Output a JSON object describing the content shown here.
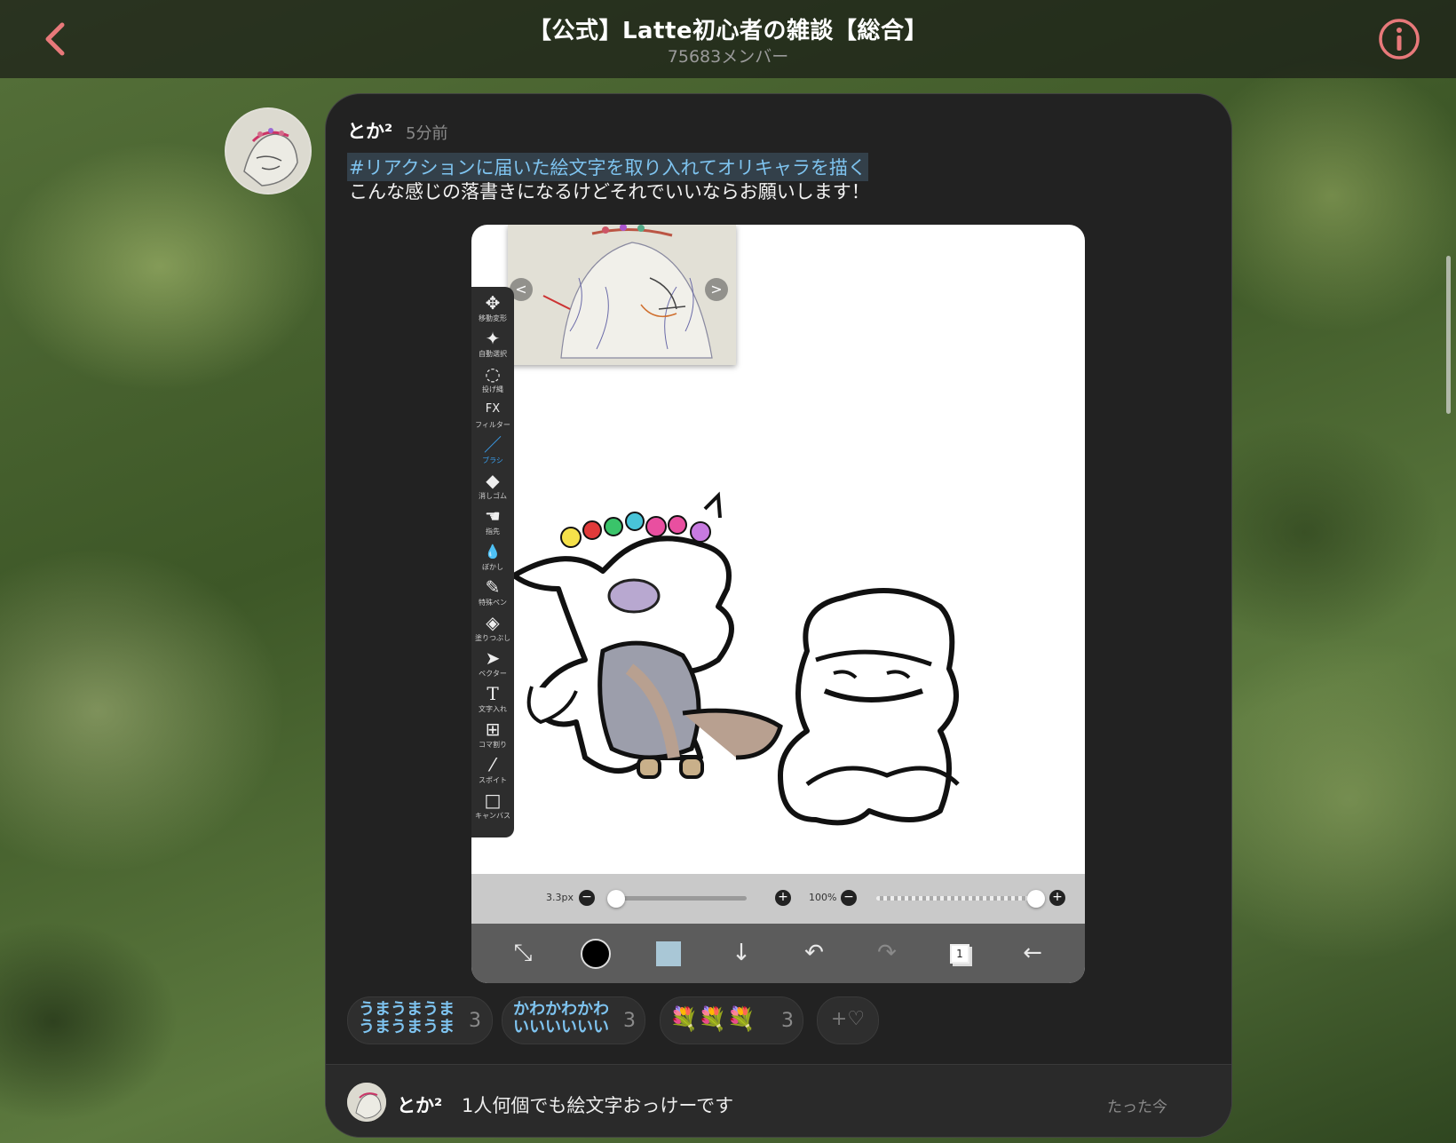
{
  "header": {
    "title": "【公式】Latte初心者の雑談【総合】",
    "member_count": "75683メンバー",
    "back_icon": "chevron-left-icon",
    "info_icon": "info-circle-icon",
    "accent_color": "#e8797a"
  },
  "post": {
    "author": "とか²",
    "time": "5分前",
    "hashtag": "#リアクションに届いた絵文字を取り入れてオリキャラを描く",
    "body": "こんな感じの落書きになるけどそれでいいならお願いします！",
    "image": {
      "tools": [
        {
          "icon": "move-transform-icon",
          "glyph": "✥",
          "label": "移動変形"
        },
        {
          "icon": "magic-wand-icon",
          "glyph": "✦",
          "label": "自動選択"
        },
        {
          "icon": "lasso-icon",
          "glyph": "◌",
          "label": "投げ縄"
        },
        {
          "icon": "filter-fx-icon",
          "glyph": "FX",
          "label": "フィルター"
        },
        {
          "icon": "brush-icon",
          "glyph": "／",
          "label": "ブラシ"
        },
        {
          "icon": "eraser-icon",
          "glyph": "◆",
          "label": "消しゴム"
        },
        {
          "icon": "smudge-icon",
          "glyph": "☚",
          "label": "指先"
        },
        {
          "icon": "blur-icon",
          "glyph": "💧",
          "label": "ぼかし"
        },
        {
          "icon": "special-pen-icon",
          "glyph": "✎",
          "label": "特殊ペン"
        },
        {
          "icon": "fill-bucket-icon",
          "glyph": "◈",
          "label": "塗りつぶし"
        },
        {
          "icon": "vector-icon",
          "glyph": "➤",
          "label": "ベクター"
        },
        {
          "icon": "text-icon",
          "glyph": "T",
          "label": "文字入れ"
        },
        {
          "icon": "frame-divider-icon",
          "glyph": "⊞",
          "label": "コマ割り"
        },
        {
          "icon": "eyedropper-icon",
          "glyph": "⁄",
          "label": "スポイト"
        },
        {
          "icon": "canvas-icon",
          "glyph": "□",
          "label": "キャンバス"
        }
      ],
      "active_tool_index": 4,
      "brush_size": "3.3px",
      "opacity": "100%",
      "brush_size_level": 0.02,
      "opacity_level": 1.0,
      "layer_number": "1",
      "bottom_icons": [
        "transform-icon",
        "color-swatch-icon",
        "secondary-color-icon",
        "download-icon",
        "undo-icon",
        "redo-icon",
        "layers-icon",
        "back-arrow-icon"
      ]
    }
  },
  "reactions": [
    {
      "text_line1": "うまうまうま",
      "text_line2": "うまうまうま",
      "count": "3"
    },
    {
      "text_line1": "かわかわかわ",
      "text_line2": "いいいいいい",
      "count": "3"
    },
    {
      "emoji": "💐💐💐",
      "count": "3"
    }
  ],
  "add_reaction": {
    "label": "+♡"
  },
  "comment": {
    "author": "とか²",
    "text": "1人何個でも絵文字おっけーです",
    "time": "たった今"
  }
}
